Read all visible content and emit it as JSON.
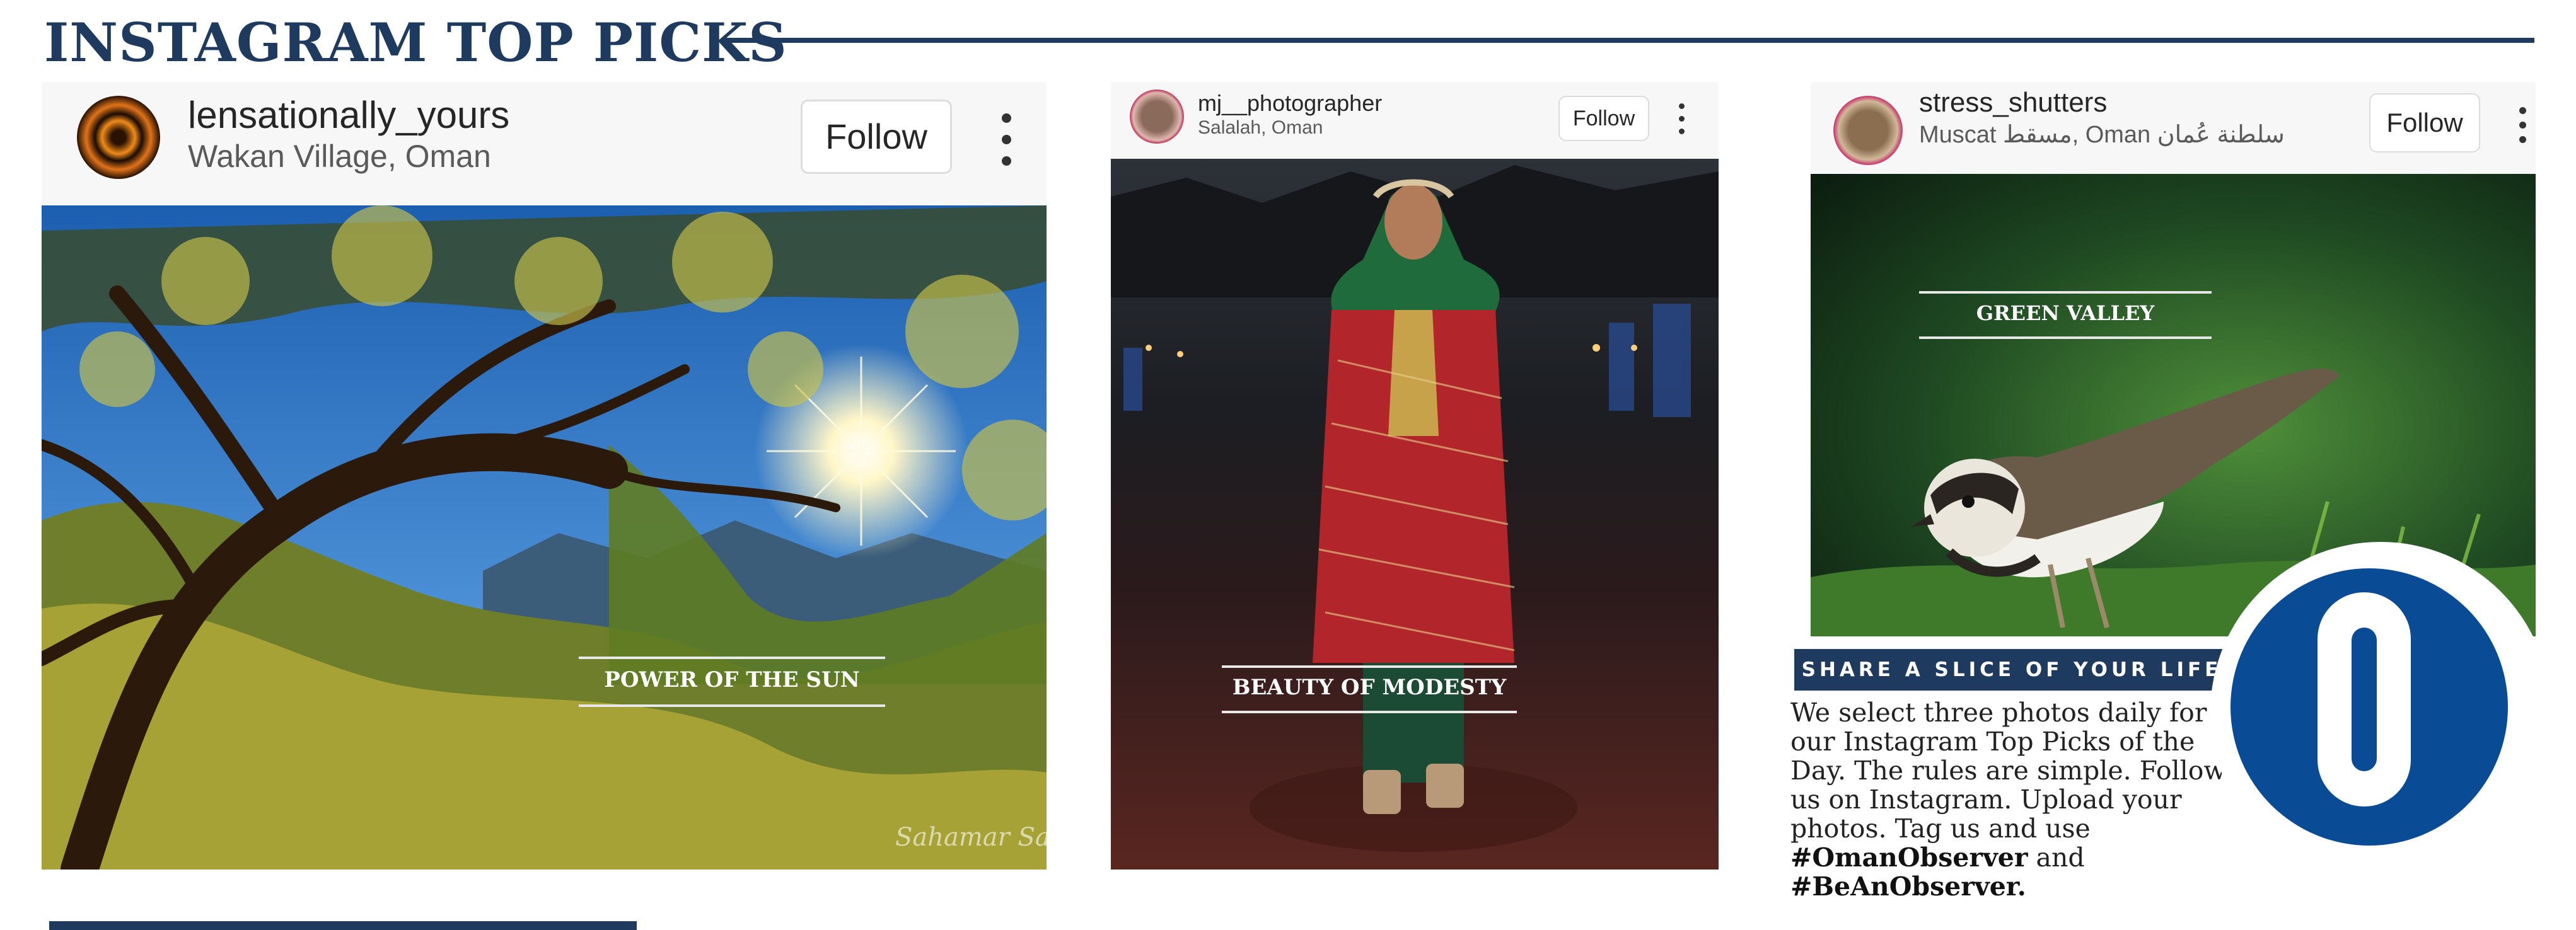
{
  "page": {
    "title": "INSTAGRAM TOP PICKS"
  },
  "posts": [
    {
      "username": "lensationally_yours",
      "location": "Wakan Village, Oman",
      "follow_label": "Follow",
      "caption": "POWER OF THE SUN",
      "watermark": "Sahamar Sadh"
    },
    {
      "username": "mj__photographer",
      "location": "Salalah, Oman",
      "follow_label": "Follow",
      "caption": "BEAUTY OF MODESTY"
    },
    {
      "username": "stress_shutters",
      "location": "Muscat مسقط, Oman سلطنة عُمان",
      "follow_label": "Follow",
      "caption": "GREEN VALLEY"
    }
  ],
  "share": {
    "banner": "SHARE A SLICE OF YOUR LIFE",
    "body": "We select three photos daily for our Instagram Top Picks of the Day. The rules are simple. Follow us on Instagram. Upload your photos. Tag us and use",
    "hashtag1": "#OmanObserver",
    "and": "and",
    "hashtag2": "#BeAnObserver."
  },
  "colors": {
    "navy": "#1f3a5f",
    "logo_blue": "#0a4b96"
  }
}
